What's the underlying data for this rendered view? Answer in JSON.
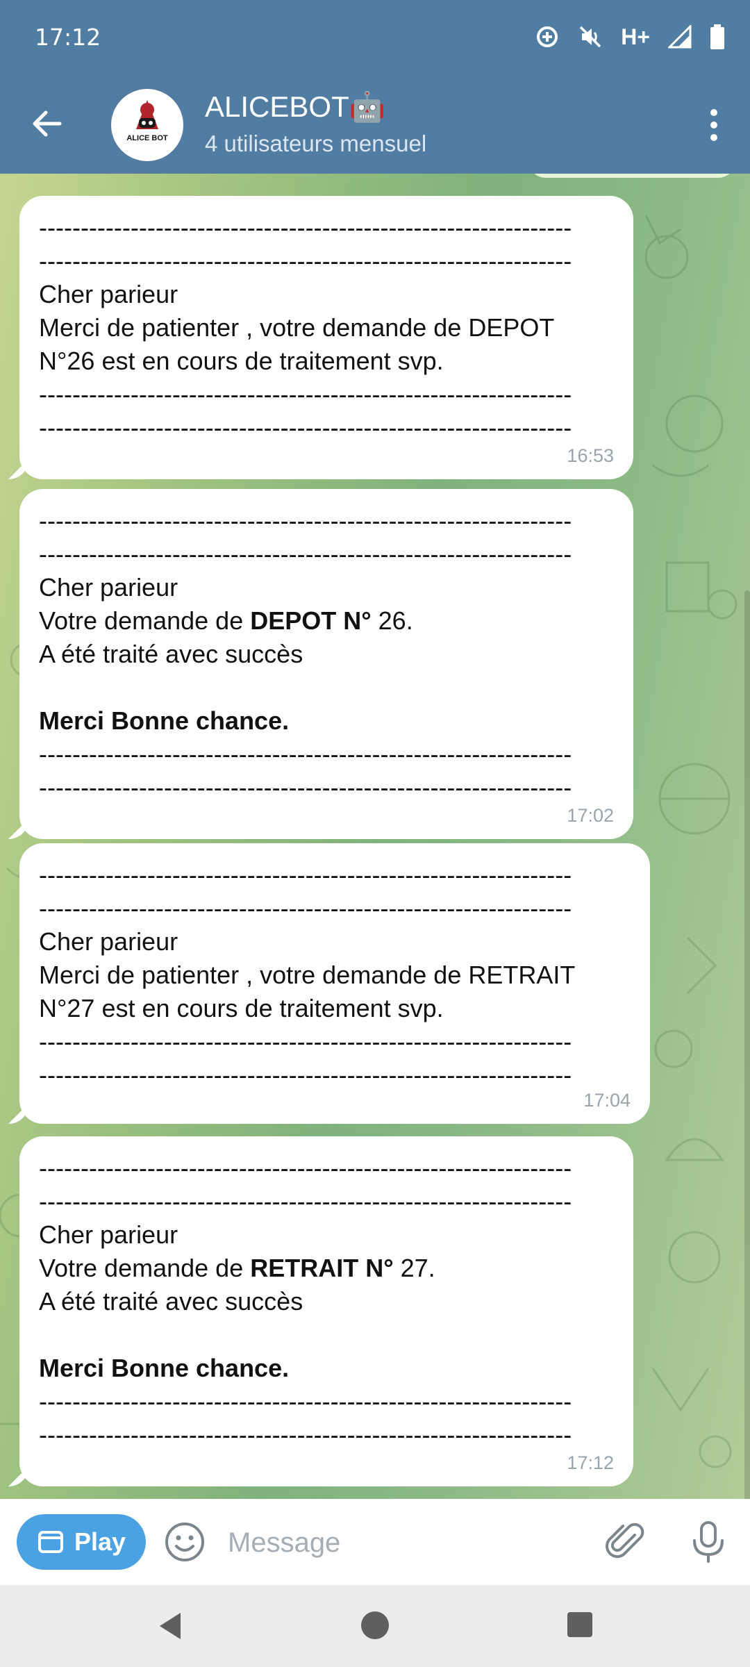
{
  "status_bar": {
    "time": "17:12",
    "network": "H+"
  },
  "header": {
    "title": "ALICEBOT🤖",
    "subtitle": "4 utilisateurs mensuel",
    "avatar_text": "ALICE BOT"
  },
  "dash_line": "----------------------------------------------------------------",
  "messages": [
    {
      "greeting": "Cher parieur",
      "line1": "Merci de patienter , votre demande de DEPOT",
      "line2": "N°26 est en cours de traitement svp.",
      "time": "16:53"
    },
    {
      "greeting": "Cher parieur",
      "line1_pre": "Votre demande de ",
      "line1_bold": "DEPOT N°",
      "line1_post": " 26.",
      "line2": "A été traité avec succès",
      "closing": "Merci Bonne chance.",
      "time": "17:02"
    },
    {
      "greeting": "Cher parieur",
      "line1": "Merci de patienter , votre demande de RETRAIT",
      "line2": "N°27 est en cours de traitement svp.",
      "time": "17:04"
    },
    {
      "greeting": "Cher parieur",
      "line1_pre": "Votre demande de ",
      "line1_bold": "RETRAIT N°",
      "line1_post": " 27.",
      "line2": "A été traité avec succès",
      "closing": "Merci Bonne chance.",
      "time": "17:12"
    }
  ],
  "input_bar": {
    "play_label": "Play",
    "placeholder": "Message"
  },
  "colors": {
    "header": "#527da3",
    "play_button": "#4aa1e4",
    "bubble": "#ffffff"
  }
}
